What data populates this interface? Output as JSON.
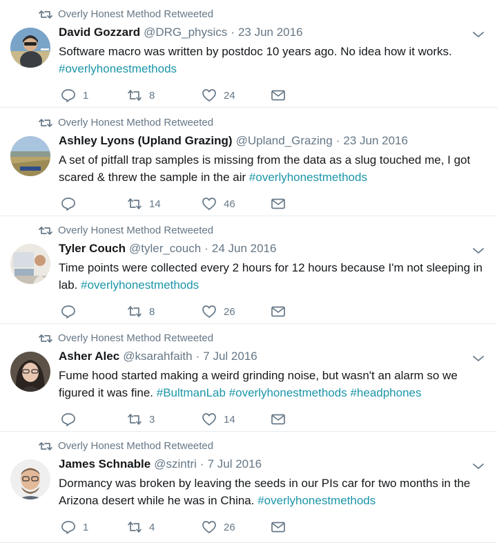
{
  "tweets": [
    {
      "retweet_label": "Overly Honest Method Retweeted",
      "name": "David Gozzard",
      "handle": "@DRG_physics",
      "date": "23 Jun 2016",
      "text_plain": "Software macro was written by postdoc 10 years ago. No idea how it works. ",
      "hashtags": [
        "#overlyhonestmethods"
      ],
      "replies": "1",
      "retweets": "8",
      "likes": "24"
    },
    {
      "retweet_label": "Overly Honest Method Retweeted",
      "name": "Ashley Lyons (Upland Grazing)",
      "handle": "@Upland_Grazing",
      "date": "23 Jun 2016",
      "text_plain": "A set of pitfall trap samples is missing from the data as a slug touched me, I got scared & threw the sample in the air ",
      "hashtags": [
        "#overlyhonestmethods"
      ],
      "replies": "",
      "retweets": "14",
      "likes": "46"
    },
    {
      "retweet_label": "Overly Honest Method Retweeted",
      "name": "Tyler Couch",
      "handle": "@tyler_couch",
      "date": "24 Jun 2016",
      "text_plain": "Time points were collected every 2 hours for 12 hours because I'm not sleeping in lab. ",
      "hashtags": [
        "#overlyhonestmethods"
      ],
      "replies": "",
      "retweets": "8",
      "likes": "26"
    },
    {
      "retweet_label": "Overly Honest Method Retweeted",
      "name": "Asher Alec",
      "handle": "@ksarahfaith",
      "date": "7 Jul 2016",
      "text_plain": "Fume hood started making a weird grinding noise, but wasn't an alarm so we figured it was fine. ",
      "hashtags": [
        "#BultmanLab",
        "#overlyhonestmethods",
        "#headphones"
      ],
      "replies": "",
      "retweets": "3",
      "likes": "14"
    },
    {
      "retweet_label": "Overly Honest Method Retweeted",
      "name": "James Schnable",
      "handle": "@szintri",
      "date": "7 Jul 2016",
      "text_plain": "Dormancy was broken by leaving the seeds in our PIs car for two months in the Arizona desert while he was in China. ",
      "hashtags": [
        "#overlyhonestmethods"
      ],
      "replies": "1",
      "retweets": "4",
      "likes": "26"
    }
  ],
  "icons": {
    "retweet": "retweet-icon",
    "reply": "reply-icon",
    "like": "heart-icon",
    "dm": "envelope-icon",
    "caret": "chevron-down-icon"
  },
  "colors": {
    "muted": "#657786",
    "hashtag": "#1b95a8",
    "text": "#14171a",
    "divider": "#e6ecf0"
  }
}
